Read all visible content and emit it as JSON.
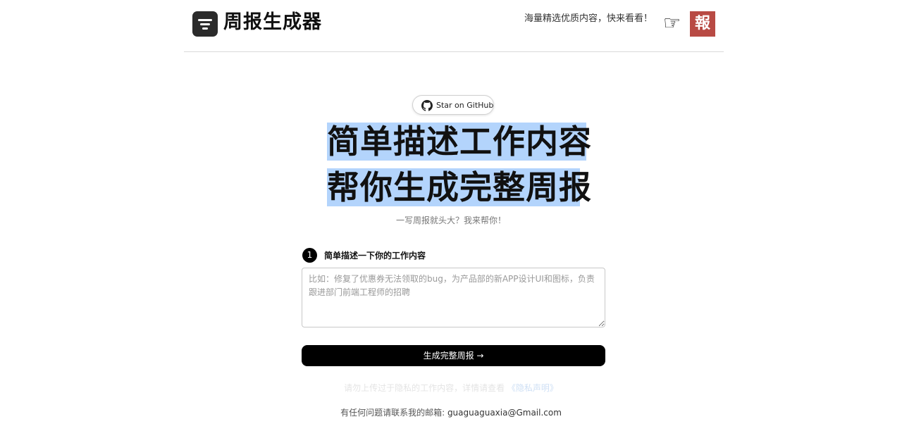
{
  "header": {
    "brand": "周报生成器",
    "slogan": "海量精选优质内容，快来看看！",
    "hand_glyph": "☞",
    "badge": "報",
    "badge_color": "#b84a44"
  },
  "github": {
    "label": "Star on GitHub"
  },
  "hero": {
    "line1": "简单描述工作内容",
    "line2": "帮你生成完整周报",
    "highlight_color": "#b3d4fc",
    "subtitle": "一写周报就头大？我来帮你！"
  },
  "form": {
    "step_number": "1",
    "step_label": "简单描述一下你的工作内容",
    "textarea_value": "",
    "textarea_placeholder": "比如：修复了优惠券无法领取的bug，为产品部的新APP设计UI和图标，负责跟进部门前端工程师的招聘",
    "submit_label": "生成完整周报 →"
  },
  "footer": {
    "privacy_text": "请勿上传过于隐私的工作内容，详情请查看",
    "privacy_link": "《隐私声明》",
    "contact_text": "有任何问题请联系我的邮箱:",
    "email": "guaguaguaxia@Gmail.com"
  }
}
